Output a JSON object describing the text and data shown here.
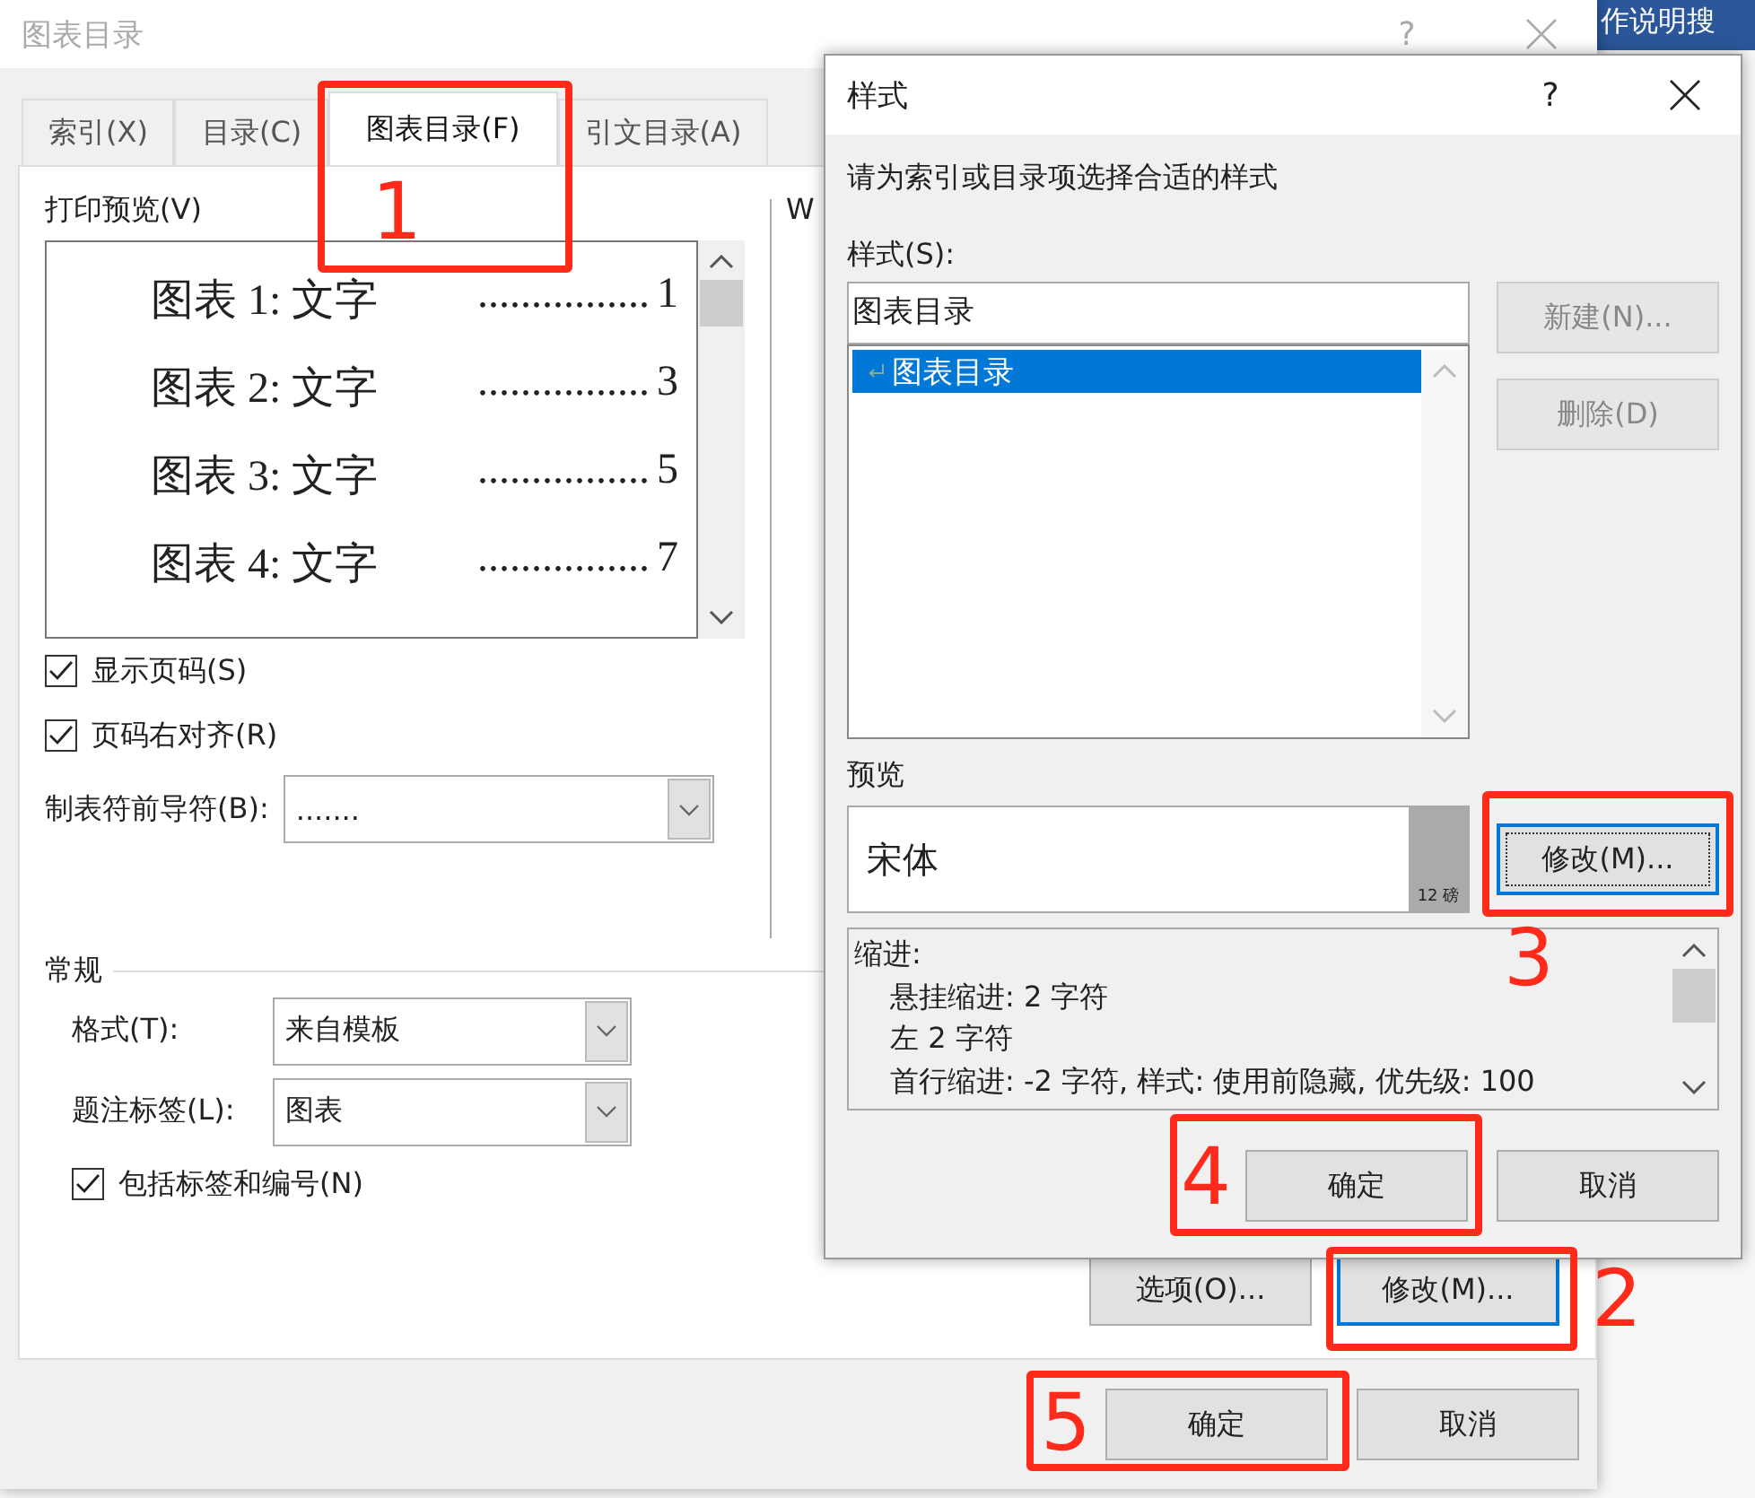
{
  "background": {
    "search_text": "作说明搜"
  },
  "main_dialog": {
    "title": "图表目录",
    "help": "?",
    "tabs": [
      {
        "label": "索引(X)",
        "selected": false
      },
      {
        "label": "目录(C)",
        "selected": false
      },
      {
        "label": "图表目录(F)",
        "selected": true,
        "annotation": "1"
      },
      {
        "label": "引文目录(A)",
        "selected": false
      }
    ],
    "print_preview": {
      "label": "打印预览(V)",
      "lines": [
        {
          "entry": "图表 1: 文字",
          "leader": "................",
          "page": "1"
        },
        {
          "entry": "图表 2: 文字",
          "leader": "................",
          "page": "3"
        },
        {
          "entry": "图表 3: 文字",
          "leader": "................",
          "page": "5"
        },
        {
          "entry": "图表 4: 文字",
          "leader": "................",
          "page": "7"
        }
      ]
    },
    "web_preview": {
      "label": "W"
    },
    "checkboxes": [
      {
        "label": "显示页码(S)",
        "checked": true
      },
      {
        "label": "页码右对齐(R)",
        "checked": true
      }
    ],
    "tab_leader": {
      "label": "制表符前导符(B):",
      "value": "......."
    },
    "general": {
      "title": "常规",
      "fields": [
        {
          "label": "格式(T):",
          "value": "来自模板"
        },
        {
          "label": "题注标签(L):",
          "value": "图表"
        }
      ],
      "include_label": {
        "label": "包括标签和编号(N)",
        "checked": true
      }
    },
    "panel_buttons": [
      {
        "label": "选项(O)...",
        "focused": false
      },
      {
        "label": "修改(M)...",
        "focused": true,
        "annotation": "2"
      }
    ],
    "buttons": [
      {
        "label": "确定",
        "annotation": "5"
      },
      {
        "label": "取消"
      }
    ]
  },
  "style_dialog": {
    "title": "样式",
    "help": "?",
    "instruction": "请为索引或目录项选择合适的样式",
    "style_label": "样式(S):",
    "style_value": "图表目录",
    "styles": [
      {
        "label": "图表目录",
        "selected": true
      }
    ],
    "side_buttons": [
      {
        "label": "新建(N)...",
        "disabled": true
      },
      {
        "label": "删除(D)",
        "disabled": true
      }
    ],
    "preview_label": "预览",
    "preview_font": "宋体",
    "preview_size": "12 磅",
    "modify": {
      "label": "修改(M)...",
      "focused": true,
      "annotation": "3"
    },
    "description": [
      {
        "text": "缩进:",
        "indented": false
      },
      {
        "text": "悬挂缩进: 2 字符",
        "indented": true
      },
      {
        "text": "左  2 字符",
        "indented": true
      },
      {
        "text": "首行缩进:  -2 字符, 样式: 使用前隐藏, 优先级: 100",
        "indented": true
      }
    ],
    "buttons": [
      {
        "label": "确定",
        "annotation": "4"
      },
      {
        "label": "取消"
      }
    ]
  }
}
